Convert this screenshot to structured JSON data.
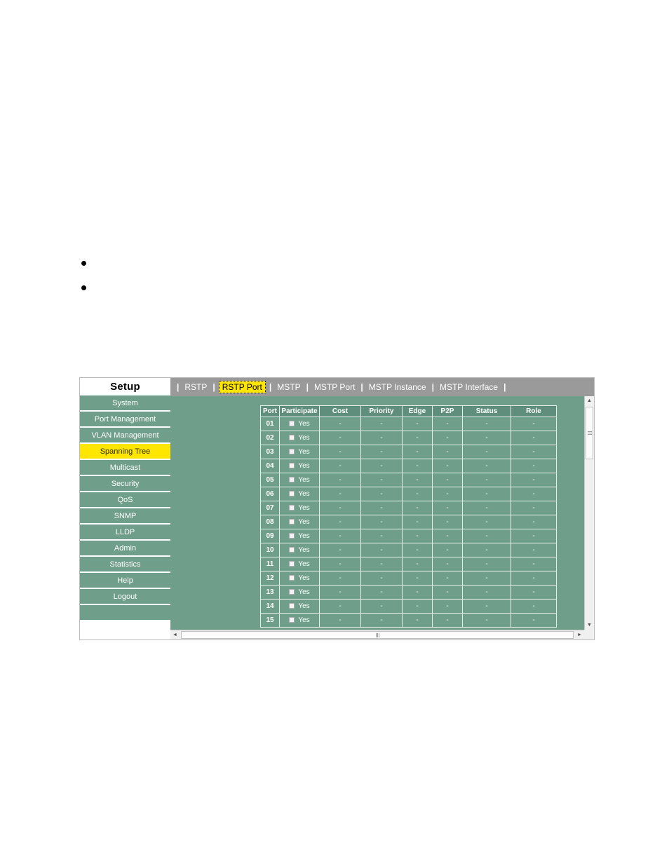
{
  "document": {
    "bullets": [
      {
        "text": ""
      },
      {
        "text": ""
      }
    ]
  },
  "colors": {
    "panel_green": "#6f9e8a",
    "header_green": "#5f8f7c",
    "tabbar_gray": "#9a9a9a",
    "highlight_yellow": "#ffe600",
    "grid_line": "#e8f0ec",
    "text_white": "#ffffff"
  },
  "sidebar": {
    "title": "Setup",
    "items": [
      {
        "label": "System",
        "active": false
      },
      {
        "label": "Port Management",
        "active": false
      },
      {
        "label": "VLAN Management",
        "active": false
      },
      {
        "label": "Spanning Tree",
        "active": true
      },
      {
        "label": "Multicast",
        "active": false
      },
      {
        "label": "Security",
        "active": false
      },
      {
        "label": "QoS",
        "active": false
      },
      {
        "label": "SNMP",
        "active": false
      },
      {
        "label": "LLDP",
        "active": false
      },
      {
        "label": "Admin",
        "active": false
      },
      {
        "label": "Statistics",
        "active": false
      },
      {
        "label": "Help",
        "active": false
      },
      {
        "label": "Logout",
        "active": false
      },
      {
        "label": "",
        "active": false
      }
    ]
  },
  "tabs": {
    "separator": "|",
    "items": [
      {
        "label": "RSTP",
        "current": false
      },
      {
        "label": "RSTP Port",
        "current": true
      },
      {
        "label": "MSTP",
        "current": false
      },
      {
        "label": "MSTP Port",
        "current": false
      },
      {
        "label": "MSTP Instance",
        "current": false
      },
      {
        "label": "MSTP Interface",
        "current": false
      }
    ]
  },
  "table": {
    "columns": [
      "Port",
      "Participate",
      "Cost",
      "Priority",
      "Edge",
      "P2P",
      "Status",
      "Role"
    ],
    "participate_label": "Yes",
    "empty_value": "-",
    "rows": [
      {
        "port": "01",
        "participate": "Yes",
        "checked": false,
        "cost": "-",
        "priority": "-",
        "edge": "-",
        "p2p": "-",
        "status": "-",
        "role": "-"
      },
      {
        "port": "02",
        "participate": "Yes",
        "checked": false,
        "cost": "-",
        "priority": "-",
        "edge": "-",
        "p2p": "-",
        "status": "-",
        "role": "-"
      },
      {
        "port": "03",
        "participate": "Yes",
        "checked": false,
        "cost": "-",
        "priority": "-",
        "edge": "-",
        "p2p": "-",
        "status": "-",
        "role": "-"
      },
      {
        "port": "04",
        "participate": "Yes",
        "checked": false,
        "cost": "-",
        "priority": "-",
        "edge": "-",
        "p2p": "-",
        "status": "-",
        "role": "-"
      },
      {
        "port": "05",
        "participate": "Yes",
        "checked": false,
        "cost": "-",
        "priority": "-",
        "edge": "-",
        "p2p": "-",
        "status": "-",
        "role": "-"
      },
      {
        "port": "06",
        "participate": "Yes",
        "checked": false,
        "cost": "-",
        "priority": "-",
        "edge": "-",
        "p2p": "-",
        "status": "-",
        "role": "-"
      },
      {
        "port": "07",
        "participate": "Yes",
        "checked": false,
        "cost": "-",
        "priority": "-",
        "edge": "-",
        "p2p": "-",
        "status": "-",
        "role": "-"
      },
      {
        "port": "08",
        "participate": "Yes",
        "checked": false,
        "cost": "-",
        "priority": "-",
        "edge": "-",
        "p2p": "-",
        "status": "-",
        "role": "-"
      },
      {
        "port": "09",
        "participate": "Yes",
        "checked": false,
        "cost": "-",
        "priority": "-",
        "edge": "-",
        "p2p": "-",
        "status": "-",
        "role": "-"
      },
      {
        "port": "10",
        "participate": "Yes",
        "checked": false,
        "cost": "-",
        "priority": "-",
        "edge": "-",
        "p2p": "-",
        "status": "-",
        "role": "-"
      },
      {
        "port": "11",
        "participate": "Yes",
        "checked": false,
        "cost": "-",
        "priority": "-",
        "edge": "-",
        "p2p": "-",
        "status": "-",
        "role": "-"
      },
      {
        "port": "12",
        "participate": "Yes",
        "checked": false,
        "cost": "-",
        "priority": "-",
        "edge": "-",
        "p2p": "-",
        "status": "-",
        "role": "-"
      },
      {
        "port": "13",
        "participate": "Yes",
        "checked": false,
        "cost": "-",
        "priority": "-",
        "edge": "-",
        "p2p": "-",
        "status": "-",
        "role": "-"
      },
      {
        "port": "14",
        "participate": "Yes",
        "checked": false,
        "cost": "-",
        "priority": "-",
        "edge": "-",
        "p2p": "-",
        "status": "-",
        "role": "-"
      },
      {
        "port": "15",
        "participate": "Yes",
        "checked": false,
        "cost": "-",
        "priority": "-",
        "edge": "-",
        "p2p": "-",
        "status": "-",
        "role": "-"
      }
    ]
  },
  "scrollbars": {
    "up_arrow": "▲",
    "down_arrow": "▼",
    "left_arrow": "◄",
    "right_arrow": "►"
  }
}
